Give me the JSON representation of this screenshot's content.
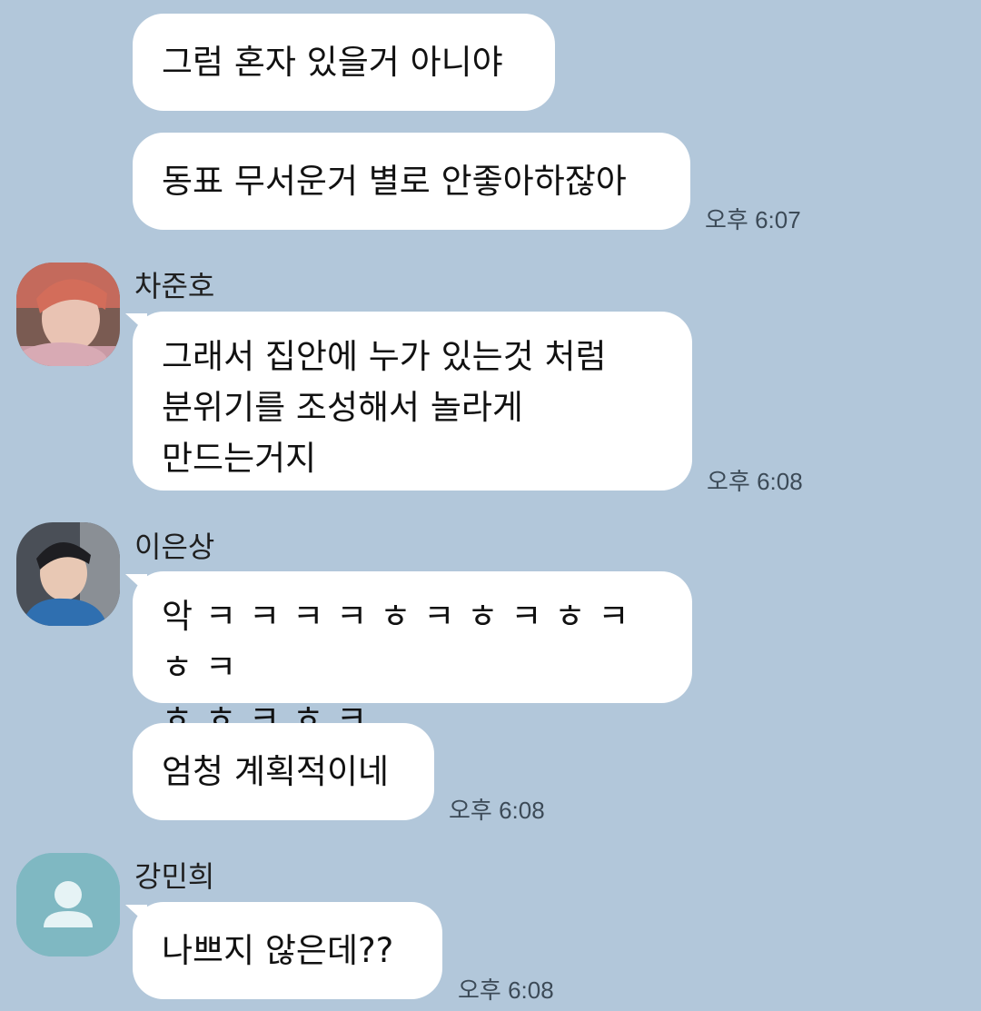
{
  "colors": {
    "chat_background": "#b2c7da",
    "bubble": "#ffffff",
    "default_avatar": "#7fb8c2"
  },
  "messages": [
    {
      "text": "그럼 혼자 있을거 아니야"
    },
    {
      "text": "동표 무서운거 별로 안좋아하잖아",
      "time": "오후 6:07"
    },
    {
      "sender": "차준호",
      "text": "그래서 집안에 누가 있는것 처럼\n분위기를 조성해서 놀라게\n만드는거지",
      "time": "오후 6:08"
    },
    {
      "sender": "이은상",
      "text": "악ㅋㅋㅋㅋㅎㅋㅎㅋㅎㅋㅎㅋ\nㅎㅎㅋㅎㅋ"
    },
    {
      "text": "엄청 계획적이네",
      "time": "오후 6:08"
    },
    {
      "sender": "강민희",
      "text": "나쁘지 않은데??",
      "time": "오후 6:08"
    }
  ]
}
